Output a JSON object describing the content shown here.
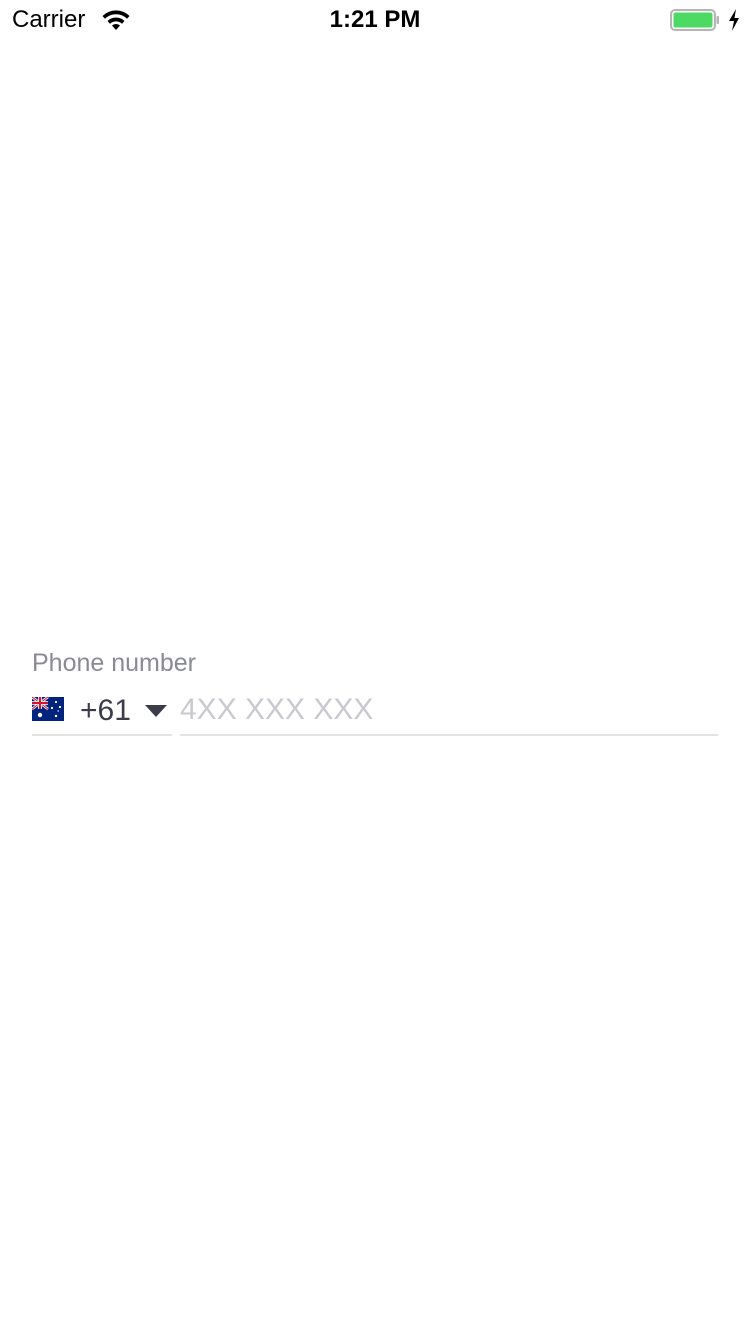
{
  "status_bar": {
    "carrier": "Carrier",
    "time": "1:21 PM",
    "battery_color": "#4cd964",
    "icons": [
      "wifi-icon",
      "battery-icon",
      "charging-bolt-icon"
    ]
  },
  "phone_form": {
    "label": "Phone number",
    "country": {
      "flag": "australia-flag-icon",
      "dial_code": "+61",
      "dropdown_icon": "caret-down-icon"
    },
    "input": {
      "value": "",
      "placeholder": "4XX XXX XXX"
    }
  },
  "colors": {
    "label": "#8a8a95",
    "text": "#3b3b4a",
    "placeholder": "#c9c9cf",
    "underline": "#e3e3e6"
  }
}
